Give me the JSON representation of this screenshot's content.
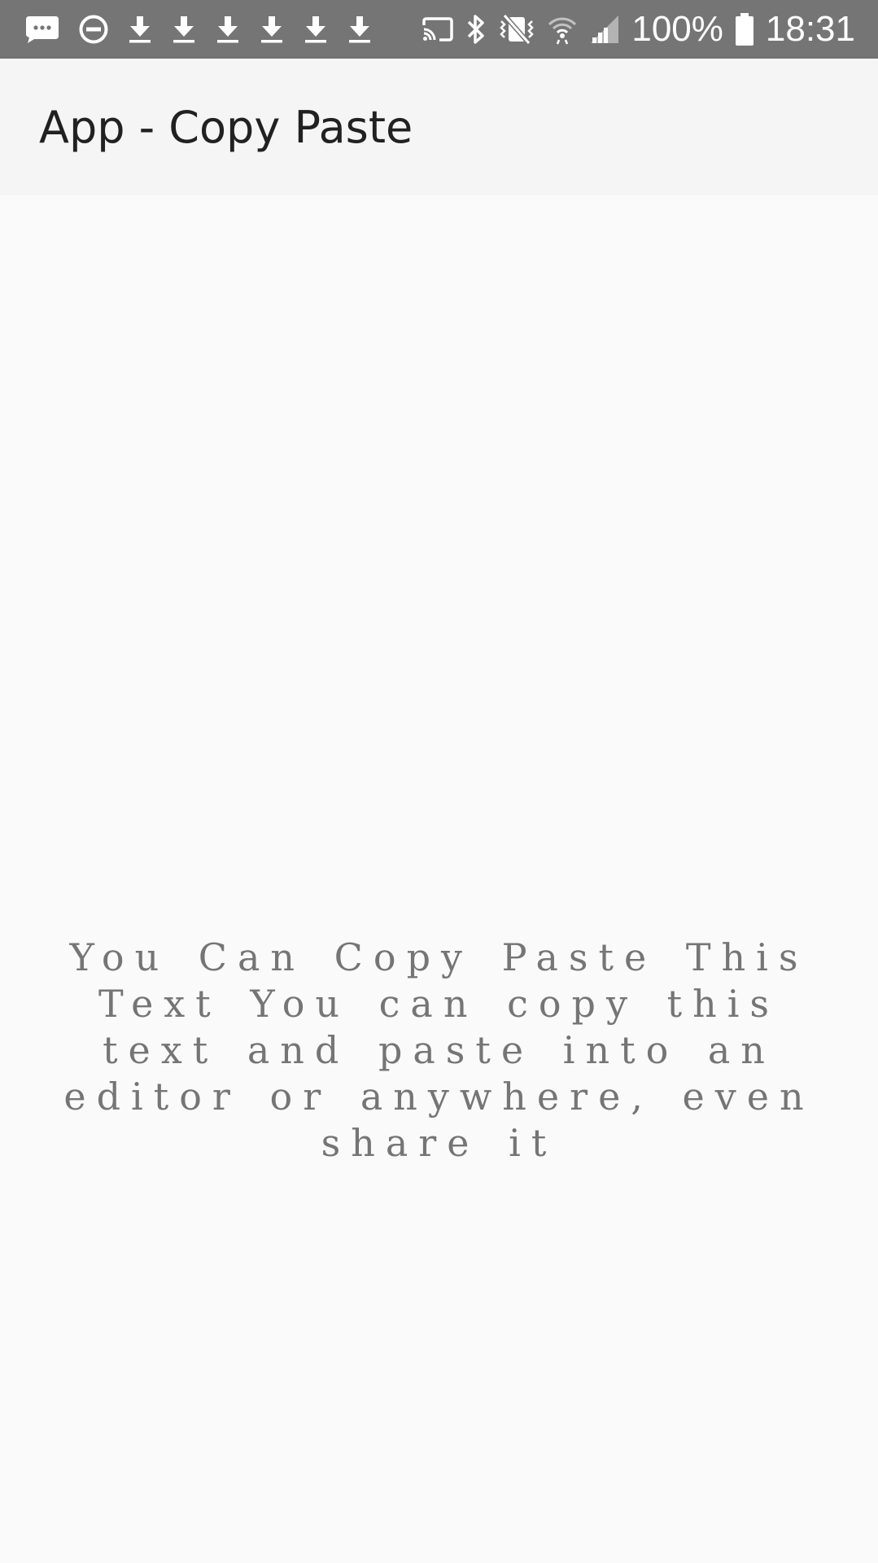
{
  "status_bar": {
    "battery": "100%",
    "time": "18:31",
    "icons_left": [
      "message-icon",
      "do-not-disturb-icon",
      "download-icon",
      "download-icon",
      "download-icon",
      "download-icon",
      "download-icon",
      "download-icon"
    ],
    "icons_right": [
      "cast-icon",
      "bluetooth-icon",
      "vibrate-mute-icon",
      "wifi-icon",
      "signal-icon",
      "battery-icon"
    ]
  },
  "app_bar": {
    "title": "App - Copy Paste"
  },
  "main": {
    "copy_text": "You Can Copy Paste This Text  You can copy this text and paste into an editor or anywhere, even share it"
  },
  "colors": {
    "status_bar_bg": "#757575",
    "app_bar_bg": "#f5f5f5",
    "background": "#fafafa",
    "title_text": "#212121",
    "body_text": "#757575"
  }
}
